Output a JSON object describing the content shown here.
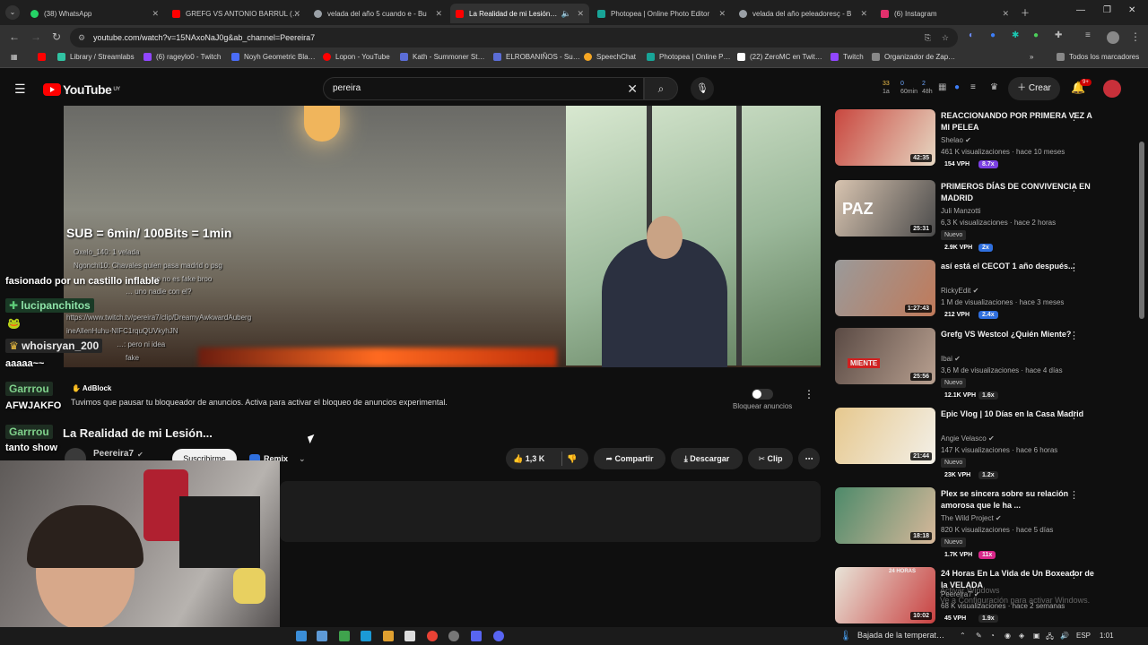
{
  "browser": {
    "tabs": [
      {
        "label": "(38) WhatsApp",
        "color": "#25d366"
      },
      {
        "label": "GREFG VS ANTONIO BARRUL (…",
        "color": "#ff0000"
      },
      {
        "label": "velada del año 5 cuando e - Bu",
        "color": "#9aa0a6"
      },
      {
        "label": "La Realidad de mi Lesión…",
        "color": "#ff0000"
      },
      {
        "label": "Photopea | Online Photo Editor",
        "color": "#18a497"
      },
      {
        "label": "velada del año peleadoresç - B",
        "color": "#9aa0a6"
      },
      {
        "label": "(6) Instagram",
        "color": "#e1306c"
      }
    ],
    "url": "youtube.com/watch?v=15NAxoNaJ0g&ab_channel=Peereira7",
    "bookmarks": [
      {
        "label": "",
        "color": "#ff0000"
      },
      {
        "label": "Library / Streamlabs",
        "color": "#31c3a2"
      },
      {
        "label": "(6) rageylo0 - Twitch",
        "color": "#9146ff"
      },
      {
        "label": "Noyh Geometric Bla…",
        "color": "#4a6cf7"
      },
      {
        "label": "Lopon - YouTube",
        "color": "#ff0000"
      },
      {
        "label": "Kath - Summoner St…",
        "color": "#5b6dd6"
      },
      {
        "label": "ELROBANIÑOS - Su…",
        "color": "#5b6dd6"
      },
      {
        "label": "SpeechChat",
        "color": "#f5a623"
      },
      {
        "label": "Photopea | Online P…",
        "color": "#18a497"
      },
      {
        "label": "(22) ZeroMC en Twit…",
        "color": "#ffffff"
      },
      {
        "label": "Twitch",
        "color": "#9146ff"
      },
      {
        "label": "Organizador de Zap…",
        "color": "#888888"
      }
    ],
    "all_bookmarks": "Todos los marcadores"
  },
  "youtube": {
    "logo": "YouTube",
    "logo_country": "UY",
    "search_value": "pereira",
    "create_label": "Crear",
    "notif_count": "9+",
    "ext_stats": [
      "33",
      "0",
      "2",
      "1a",
      "60min",
      "48h"
    ]
  },
  "video_overlay": {
    "sub_text": "SUB = 6min/ 100Bits = 1min",
    "chat_small": [
      "Oxelo_140: 1 velada",
      "Ngonchi10: Chavales quien pasa madrid o psg",
      "…: …so no es fake broo",
      "… uno nadie con el?",
      "https://www.twitch.tv/pereira7/clip/DreamyAwkwardAuberg",
      "ineAllenHuhu-NIFC1rquQUVkyhJN",
      "…: pero ni idea",
      "fake"
    ],
    "chat_big": [
      {
        "name": "",
        "message": "fasionado por un castillo inflable",
        "color": "#ffffff"
      },
      {
        "name": "lucipanchitos",
        "message": "",
        "color": "#8ee3a8"
      },
      {
        "name": "whoisryan_200",
        "message": "aaaaa~~",
        "color": "#e6e6e6"
      },
      {
        "name": "Garrrou",
        "message": "AFWJAKFO",
        "color": "#7fd18b"
      },
      {
        "name": "Garrrou",
        "message": "tanto show",
        "color": "#7fd18b"
      }
    ]
  },
  "adblock": {
    "brand": "AdBlock",
    "message": "Tuvimos que pausar tu bloqueador de anuncios. Activa para activar el bloqueo de anuncios experimental.",
    "toggle_label": "Bloquear anuncios"
  },
  "video": {
    "title": "La Realidad de mi Lesión...",
    "channel": "Peereira7",
    "subscribe": "Suscribirme",
    "remix": "Remix",
    "likes": "1,3 K",
    "share": "Compartir",
    "download": "Descargar",
    "clip": "Clip"
  },
  "sidebar": [
    {
      "title": "REACCIONANDO POR PRIMERA VEZ A MI PELEA",
      "channel": "Shelao",
      "meta": "461 K visualizaciones · hace 10 meses",
      "duration": "42:35",
      "badge": "",
      "vph": "154 VPH",
      "mult": "8.7x",
      "mult_color": "#7b3fe4",
      "thumb": [
        "#c9473f",
        "#e6d7c2"
      ]
    },
    {
      "title": "PRIMEROS DÍAS DE CONVIVENCIA EN MADRID",
      "channel": "Juli Manzotti",
      "meta": "6,3 K visualizaciones · hace 2 horas",
      "duration": "25:31",
      "badge": "Nuevo",
      "vph": "2.9K VPH",
      "mult": "2x",
      "mult_color": "#2f6fde",
      "thumb": [
        "#d8c4b0",
        "#4b4b4b"
      ]
    },
    {
      "title": "así está el CECOT 1 año después...",
      "channel": "RickyEdit",
      "meta": "1 M de visualizaciones · hace 3 meses",
      "duration": "1:27:43",
      "badge": "",
      "vph": "212 VPH",
      "mult": "2.4x",
      "mult_color": "#2f6fde",
      "thumb": [
        "#9a9a9a",
        "#c07a5a"
      ]
    },
    {
      "title": "Grefg VS Westcol ¿Quién Miente?",
      "channel": "Ibai",
      "meta": "3,6 M de visualizaciones · hace 4 días",
      "duration": "25:56",
      "badge": "Nuevo",
      "vph": "12.1K VPH",
      "mult": "1.6x",
      "mult_color": "#272727",
      "thumb": [
        "#5a4a44",
        "#b8a090"
      ]
    },
    {
      "title": "Epic Vlog | 10 Días en la Casa Madrid",
      "channel": "Angie Velasco",
      "meta": "147 K visualizaciones · hace 6 horas",
      "duration": "21:44",
      "badge": "Nuevo",
      "vph": "23K VPH",
      "mult": "1.2x",
      "mult_color": "#272727",
      "thumb": [
        "#e6c88e",
        "#f3f0e8"
      ]
    },
    {
      "title": "Plex se sincera sobre su relación amorosa que le ha ...",
      "channel": "The Wild Project",
      "meta": "820 K visualizaciones · hace 5 días",
      "duration": "18:18",
      "badge": "Nuevo",
      "vph": "1.7K VPH",
      "mult": "11x",
      "mult_color": "#d8278a",
      "thumb": [
        "#4d8a6a",
        "#d7b89a"
      ]
    },
    {
      "title": "24 Horas En La Vida de Un Boxeador de la VELADA",
      "channel": "Peereira7",
      "meta": "68 K visualizaciones · hace 2 semanas",
      "duration": "10:02",
      "badge": "",
      "vph": "45 VPH",
      "mult": "1.9x",
      "mult_color": "#272727",
      "thumb": [
        "#e8e4d8",
        "#c84040"
      ]
    }
  ],
  "taskbar": {
    "weather": "Bajada de la temperat…",
    "lang": "ESP",
    "time": "1:01"
  },
  "watermark": "Activar Windows\nVe a Configuración para activar Windows."
}
